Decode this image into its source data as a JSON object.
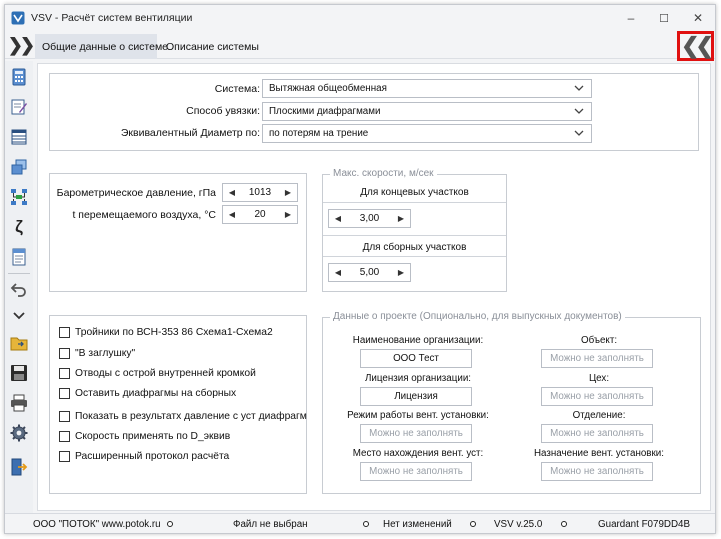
{
  "window": {
    "title": "VSV - Расчёт систем вентиляции",
    "min_glyph": "–",
    "max_glyph": "☐",
    "close_glyph": "✕"
  },
  "tabs": [
    {
      "label": "Общие данные о системе",
      "active": true
    },
    {
      "label": "Описание системы",
      "active": false
    }
  ],
  "expand_glyph": "❯❯",
  "collapse_glyph": "❮❮",
  "toolbar_icons": [
    "calculator-icon",
    "edit-document-icon",
    "table-icon",
    "copy-windows-icon",
    "network-scheme-icon",
    "zeta-icon",
    "text-document-icon",
    "undo-icon",
    "chevron-down-icon",
    "open-folder-icon",
    "save-disk-icon",
    "printer-icon",
    "settings-gear-icon",
    "exit-icon"
  ],
  "system_panel": {
    "system_label": "Система:",
    "system_value": "Вытяжная  общеобменная",
    "link_label": "Способ увязки:",
    "link_value": "Плоскими диафрагмами",
    "diam_label": "Эквивалентный Диаметр по:",
    "diam_value": "по потерям на трение"
  },
  "params": {
    "pressure_label": "Барометрическое давление, гПа",
    "pressure_value": "1013",
    "temp_label": "t перемещаемого воздуха, °С",
    "temp_value": "20"
  },
  "speeds": {
    "title": "Макс. скорости, м/сек",
    "end_label": "Для концевых участков",
    "end_value": "3,00",
    "collect_label": "Для сборных участков",
    "collect_value": "5,00"
  },
  "options": [
    {
      "label": "Тройники по  ВСН-353 86 Схема1-Схема2",
      "checked": false
    },
    {
      "label": "\"В заглушку\"",
      "checked": false
    },
    {
      "label": "Отводы с острой внутренней кромкой",
      "checked": false
    },
    {
      "label": "Оставить диафрагмы на сборных",
      "checked": false
    },
    {
      "label": "Показать в результатх давление с уст диафрагм",
      "checked": false
    },
    {
      "label": "Скорость применять по D_эквив",
      "checked": false
    },
    {
      "label": "Расширенный протокол расчёта",
      "checked": false
    }
  ],
  "project": {
    "title": "Данные о проекте (Опционально, для выпускных документов)",
    "fields": [
      {
        "label": "Наименование организации:",
        "value": "ООО Тест",
        "placeholder": false
      },
      {
        "label": "Объект:",
        "value": "Можно не заполнять",
        "placeholder": true
      },
      {
        "label": "Лицензия организации:",
        "value": "Лицензия",
        "placeholder": false
      },
      {
        "label": "Цех:",
        "value": "Можно не заполнять",
        "placeholder": true
      },
      {
        "label": "Режим работы вент. установки:",
        "value": "Можно не заполнять",
        "placeholder": true
      },
      {
        "label": "Отделение:",
        "value": "Можно не заполнять",
        "placeholder": true
      },
      {
        "label": "Место нахождения вент. уст:",
        "value": "Можно не заполнять",
        "placeholder": true
      },
      {
        "label": "Назначение вент. установки:",
        "value": "Можно не заполнять",
        "placeholder": true
      }
    ]
  },
  "status": {
    "company": "ООО \"ПОТОК\" www.potok.ru",
    "file": "Файл не выбран",
    "changes": "Нет изменений",
    "version": "VSV v.25.0",
    "guardant": "Guardant F079DD4B"
  },
  "colors": {
    "highlight": "#e01010",
    "active_tab": "#dfe3ea",
    "placeholder": "#9aa0a8"
  }
}
